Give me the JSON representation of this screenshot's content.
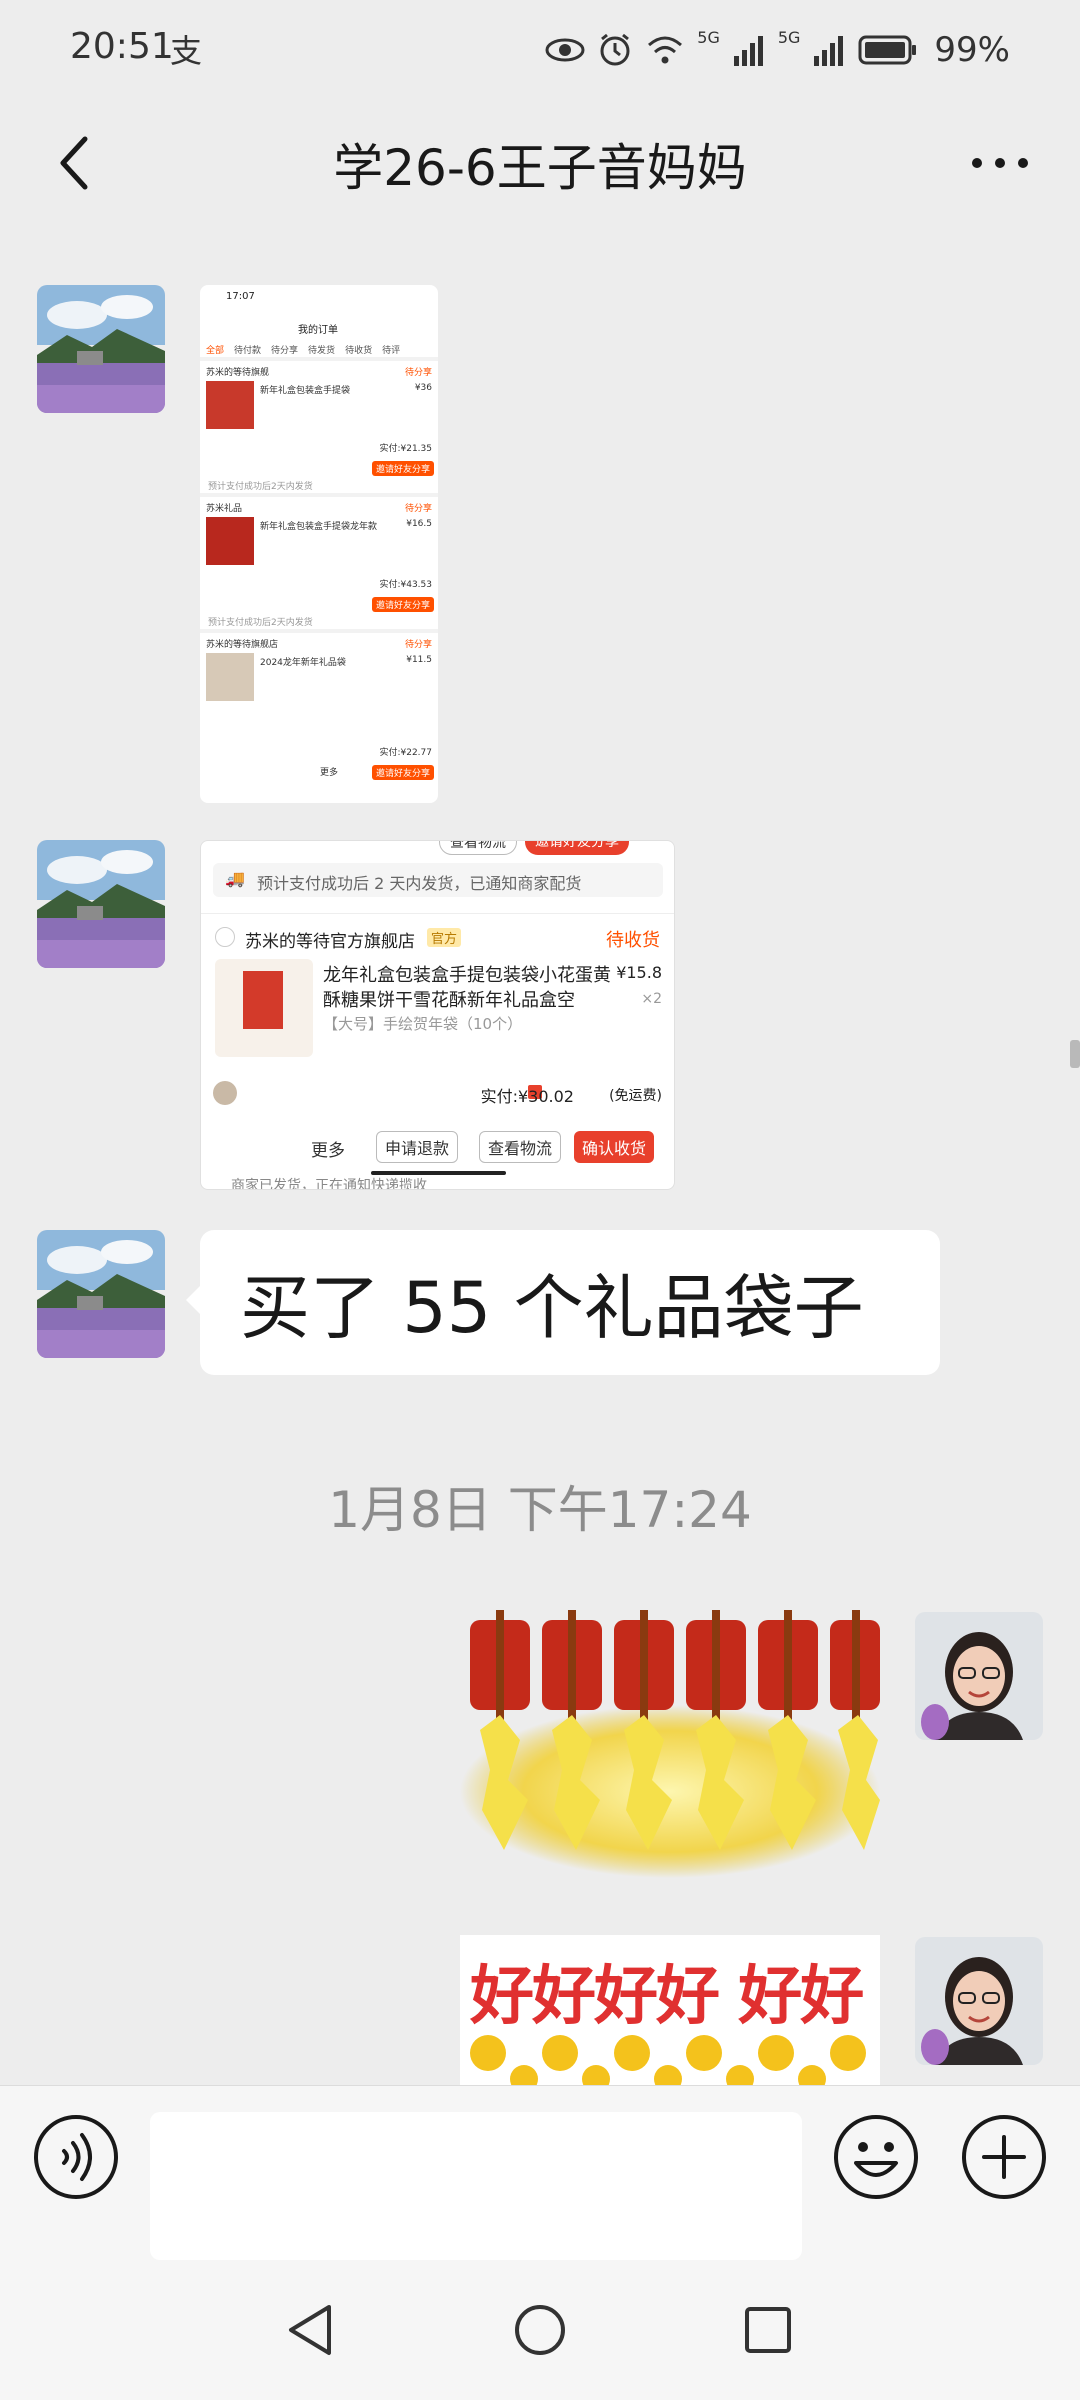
{
  "status_bar": {
    "time": "20:51",
    "alipay_glyph": "支",
    "battery": "99%",
    "network_1": "5G",
    "network_2": "5G"
  },
  "title_bar": {
    "title": "学26-6王子音妈妈",
    "more_glyph": "···"
  },
  "shot1": {
    "time": "17:07",
    "header": "我的订单",
    "tabs": [
      "全部",
      "待付款",
      "待分享",
      "待发货",
      "待收货",
      "待评"
    ],
    "stores": [
      {
        "name": "苏米的等待旗舰",
        "status": "待分享",
        "item": "新年礼盒包装盒手提袋",
        "price": "¥36",
        "paid": "实付:¥21.35",
        "btn": "邀请好友分享"
      },
      {
        "name": "苏米礼品",
        "status": "待分享",
        "item": "新年礼盒包装盒手提袋龙年款",
        "price": "¥16.5",
        "paid": "实付:¥43.53",
        "btn": "邀请好友分享"
      },
      {
        "name": "苏米的等待旗舰店",
        "status": "待分享",
        "item": "2024龙年新年礼品袋",
        "price": "¥11.5",
        "paid": "实付:¥22.77",
        "btn": "邀请好友分享"
      }
    ],
    "pending_note": "预计支付成功后2天内发货",
    "more": "更多"
  },
  "shot2": {
    "top_buttons": [
      "查看物流",
      "邀请好友分享"
    ],
    "notice": "预计支付成功后 2 天内发货，已通知商家配货",
    "store": "苏米的等待官方旗舰店",
    "store_badge": "官方",
    "status": "待收货",
    "product_line1": "龙年礼盒包装盒手提包装袋小花蛋黄",
    "product_line2": "酥糖果饼干雪花酥新年礼品盒空",
    "spec": "【大号】手绘贺年袋（10个）",
    "price": "¥15.8",
    "qty": "×2",
    "paid": "实付:¥30.02",
    "shipping": "(免运费)",
    "buttons": [
      "更多",
      "申请退款",
      "查看物流",
      "确认收货"
    ],
    "bottom_notice": "商家已发货，正在通知快递揽收"
  },
  "message_text": "买了 55 个礼品袋子",
  "timestamp": "1月8日 下午17:24",
  "sticker2_text": "好好好好 好好",
  "colors": {
    "background": "#ededed",
    "taobao_orange": "#ff5000",
    "confirm_red": "#e8402c",
    "bubble": "#ffffff",
    "timestamp": "#8c8c8c"
  },
  "icons": {
    "back": "chevron-left-icon",
    "more": "more-dots-icon",
    "voice": "voice-icon",
    "emoji": "emoji-icon",
    "plus": "plus-icon"
  }
}
